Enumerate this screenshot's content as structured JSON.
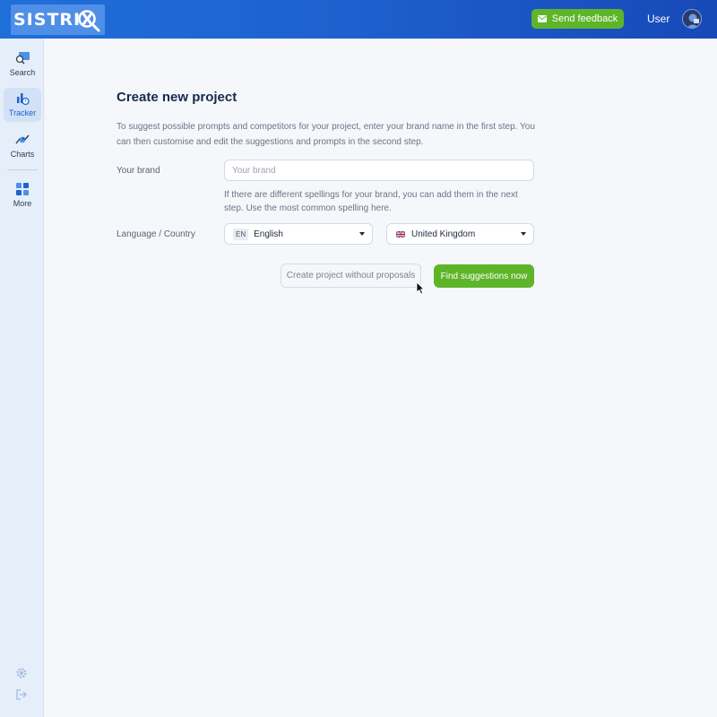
{
  "header": {
    "logo_text": "SISTRIX",
    "feedback_label": "Send feedback",
    "user_label": "User",
    "brand_color": "#1f6fd8"
  },
  "sidebar": {
    "items": [
      {
        "label": "Search",
        "icon": "search-icon"
      },
      {
        "label": "Tracker",
        "icon": "tracker-icon",
        "active": true
      },
      {
        "label": "Charts",
        "icon": "charts-icon"
      },
      {
        "label": "More",
        "icon": "grid-icon"
      }
    ],
    "bottom_icons": [
      "gear-icon",
      "logout-icon"
    ]
  },
  "main": {
    "title": "Create new project",
    "intro": "To suggest possible prompts and competitors for your project, enter your brand name in the first step. You can then customise and edit the suggestions and prompts in the second step.",
    "brand_label": "Your brand",
    "brand_placeholder": "Your brand",
    "brand_value": "",
    "brand_hint": "If there are different spellings for your brand, you can add them in the next step. Use the most common spelling here.",
    "lang_country_label": "Language / Country",
    "language": {
      "code": "EN",
      "value": "English"
    },
    "country": {
      "flag": "uk-flag-icon",
      "value": "United Kingdom"
    },
    "secondary_button": "Create project without proposals",
    "primary_button": "Find suggestions now",
    "accent_green": "#5eb52a"
  }
}
